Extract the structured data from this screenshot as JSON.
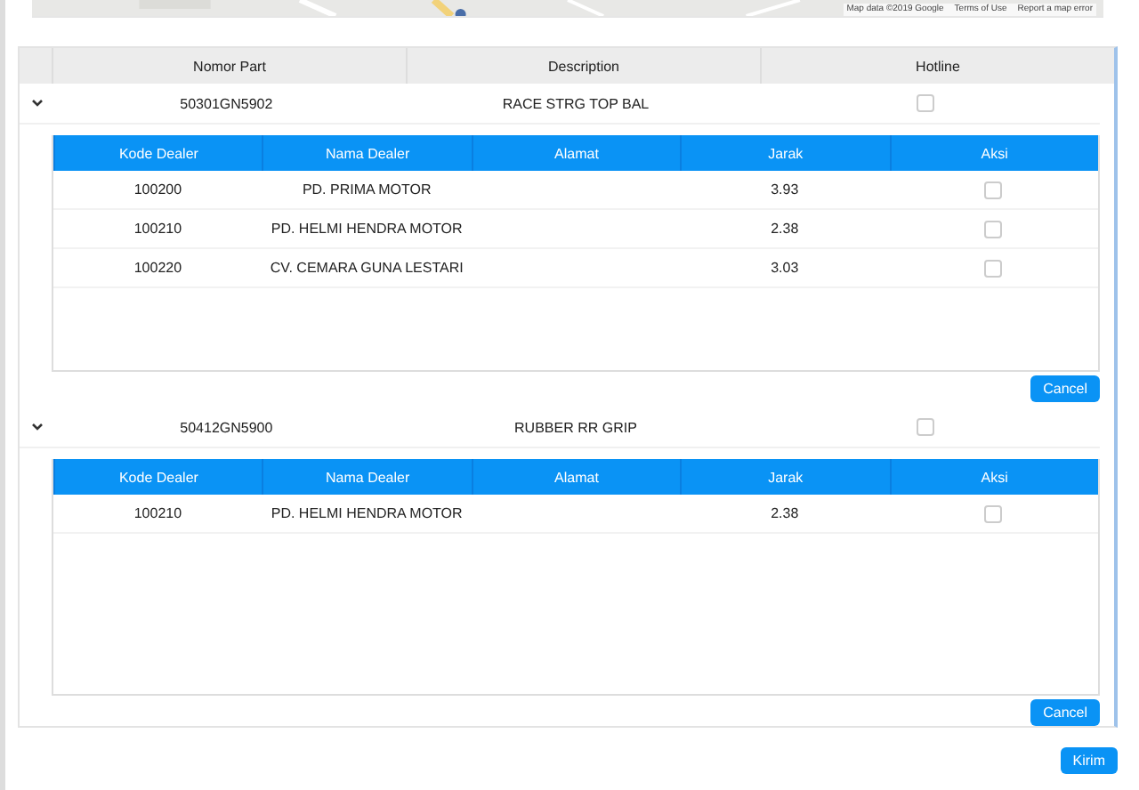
{
  "map": {
    "attribution": [
      "Map data ©2019 Google",
      "Terms of Use",
      "Report a map error"
    ]
  },
  "parts_table": {
    "columns": [
      "Nomor Part",
      "Description",
      "Hotline"
    ],
    "rows": [
      {
        "expanded": true,
        "nomor_part": "50301GN5902",
        "description": "RACE STRG TOP BAL",
        "hotline": false,
        "dealers": {
          "columns": [
            "Kode Dealer",
            "Nama Dealer",
            "Alamat",
            "Jarak",
            "Aksi"
          ],
          "rows": [
            {
              "kode": "100200",
              "nama": "PD. PRIMA MOTOR",
              "jarak": "3.93",
              "checked": false
            },
            {
              "kode": "100210",
              "nama": "PD. HELMI HENDRA MOTOR",
              "jarak": "2.38",
              "checked": false
            },
            {
              "kode": "100220",
              "nama": "CV. CEMARA GUNA LESTARI",
              "jarak": "3.03",
              "checked": false
            }
          ]
        },
        "cancel": "Cancel"
      },
      {
        "expanded": true,
        "nomor_part": "50412GN5900",
        "description": "RUBBER RR GRIP",
        "hotline": false,
        "dealers": {
          "columns": [
            "Kode Dealer",
            "Nama Dealer",
            "Alamat",
            "Jarak",
            "Aksi"
          ],
          "rows": [
            {
              "kode": "100210",
              "nama": "PD. HELMI HENDRA MOTOR",
              "jarak": "2.38",
              "checked": false
            }
          ]
        },
        "cancel": "Cancel"
      }
    ]
  },
  "submit": "Kirim"
}
